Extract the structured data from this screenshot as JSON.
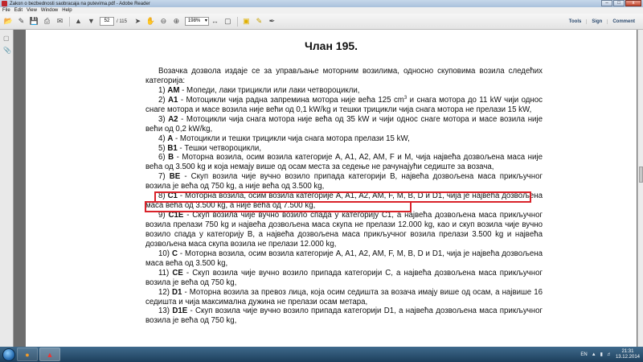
{
  "window": {
    "title": "Zakon o bezbednosti saobracaja na putevima.pdf - Adobe Reader",
    "controls": {
      "minimize": "–",
      "maximize": "□",
      "close": "x"
    }
  },
  "menu": [
    "File",
    "Edit",
    "View",
    "Window",
    "Help"
  ],
  "toolbar": {
    "current_page": "52",
    "total_pages": "/ 115",
    "zoom": "198%",
    "right": {
      "tools": "Tools",
      "sign": "Sign",
      "comment": "Comment"
    }
  },
  "document": {
    "heading": "Члан 195.",
    "intro": "Возачка дозвола издаје се за управљање моторним возилима, односно скуповима возила следећих категорија:",
    "items": [
      {
        "num": "1)",
        "cat": "AM",
        "text": " - Мопеди, лаки трицикли или лаки четвороцикли,"
      },
      {
        "num": "2)",
        "cat": "A1",
        "pre": " - Мотоцикли чија радна запремина мотора није већа 125 cm",
        "sup": "3",
        "post": " и снага мотора до 11 kW чији однос снаге мотора и масе возила није већи од 0,1 kW/kg и тешки трицикли чија снага мотора не прелази 15 kW,"
      },
      {
        "num": "3)",
        "cat": "A2",
        "text": " - Мотоцикли чија снага мотора није већа од 35 kW и чији однос снаге мотора и масе возила није већи од 0,2 kW/kg,"
      },
      {
        "num": "4)",
        "cat": "A",
        "text": " - Мотоцикли и тешки трицикли чија снага мотора прелази 15 kW,"
      },
      {
        "num": "5)",
        "cat": "B1",
        "text": " - Тешки четвороцикли,"
      },
      {
        "num": "6)",
        "cat": "B",
        "text": " - Моторна возила, осим возила категорије A, A1, A2, AM, F и M, чија највећа дозвољена маса није већа од 3.500 kg и која немају више од осам места за седење не рачунајући седиште за возача,"
      },
      {
        "num": "7)",
        "cat": "BE",
        "text": " - Скуп возила чије вучно возило припада категорији B, највећа дозвољена маса прикључног возила је већа од 750 kg, а није већа од 3.500 kg,"
      },
      {
        "num": "8)",
        "cat": "C1",
        "text": " - Моторна возила, осим возила категорије A, A1, A2, AM, F, M, B, D и D1, чија је највећа дозвољена маса већа од 3.500 kg, а није већа од 7.500 kg,"
      },
      {
        "num": "9)",
        "cat": "C1E",
        "text": " - Скуп возила чије вучно возило спада у категорију C1, а највећа дозвољена маса прикључног возила прелази 750 kg и највећа дозвољена маса скупа не прелази 12.000 kg, као и скуп возила чије вучно возило спада у категорију B, а највећа дозвољена маса прикључног возила прелази 3.500 kg и највећа дозвољена маса скупа возила не прелази 12.000 kg,"
      },
      {
        "num": "10)",
        "cat": "C",
        "text": " - Моторна возила, осим возила категорије A, A1, A2, AM, F, M, B, D и D1, чија је највећа дозвољена маса већа од 3.500 kg,"
      },
      {
        "num": "11)",
        "cat": "CE",
        "text": " - Скуп возила чије вучно возило припада категорији C, а највећа дозвољена маса прикључног возила је већа од 750 kg,"
      },
      {
        "num": "12)",
        "cat": "D1",
        "text": " - Моторна возила за превоз лица, која осим седишта за возача имају више од осам, а највише 16 седишта и чија максимална дужина не прелази осам метара,"
      },
      {
        "num": "13)",
        "cat": "D1E",
        "text": " - Скуп возила чије вучно возило припада категорији D1, а највећа дозвољена маса прикључног возила је већа од 750 kg,"
      }
    ]
  },
  "taskbar": {
    "language": "EN",
    "time": "21:31",
    "date": "13.12.2014"
  },
  "colors": {
    "highlight": "#d9232a",
    "title_bar": "#b8cce3",
    "taskbar": "#2b5274"
  }
}
